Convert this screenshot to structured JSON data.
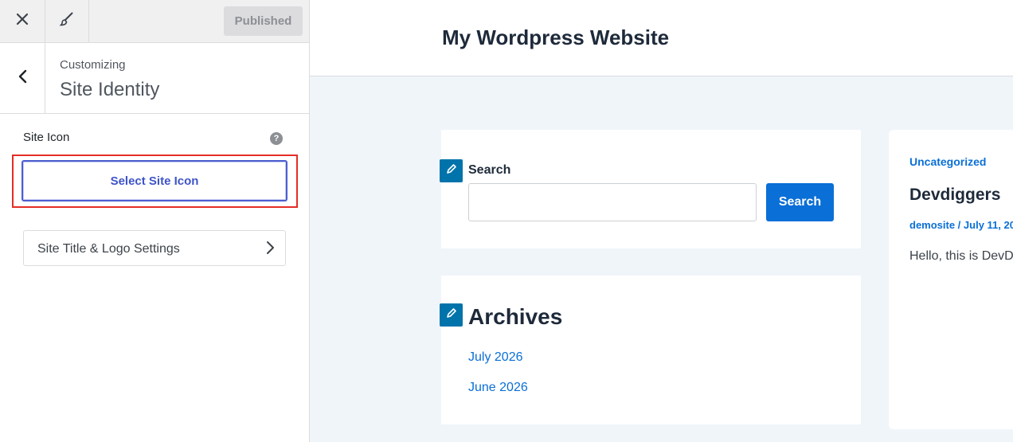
{
  "customizer": {
    "published_label": "Published",
    "breadcrumb": "Customizing",
    "section_title": "Site Identity",
    "site_icon_label": "Site Icon",
    "help_glyph": "?",
    "select_site_icon_label": "Select Site Icon",
    "subsection_label": "Site Title & Logo Settings"
  },
  "preview": {
    "site_title": "My Wordpress Website",
    "search_widget": {
      "label": "Search",
      "input_value": "",
      "button_label": "Search"
    },
    "archives_widget": {
      "title": "Archives",
      "links": [
        "July 2026",
        "June 2026"
      ]
    },
    "post": {
      "category": "Uncategorized",
      "title": "Devdiggers",
      "meta": "demosite / July 11, 20",
      "excerpt": "Hello, this is DevD"
    }
  },
  "colors": {
    "accent": "#0a6fd6",
    "highlight_border": "#e52d27",
    "select_button": "#3e54c8"
  }
}
